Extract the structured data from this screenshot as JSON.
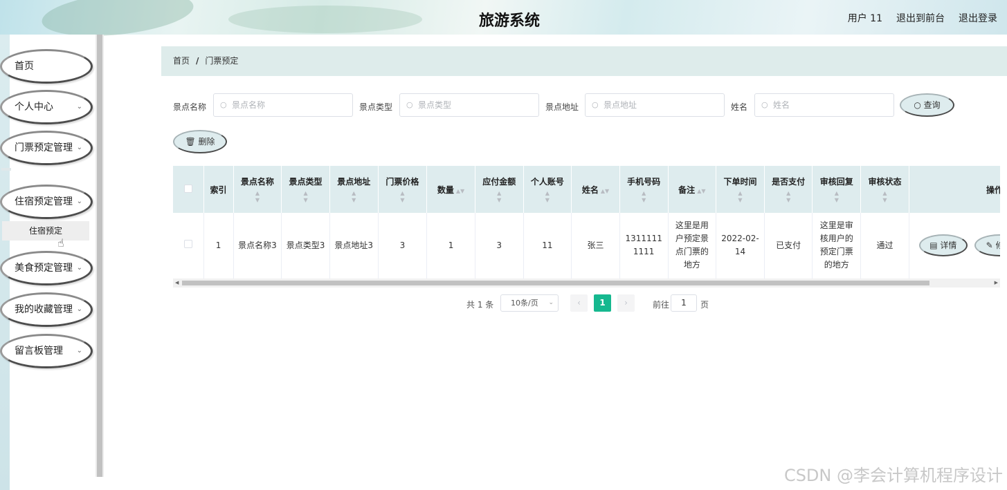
{
  "header": {
    "title": "旅游系统",
    "user": "用户 11",
    "back_front": "退出到前台",
    "logout": "退出登录"
  },
  "sidebar": {
    "items": [
      {
        "label": "首页",
        "has_chevron": false
      },
      {
        "label": "个人中心",
        "has_chevron": true
      },
      {
        "label": "门票预定管理",
        "has_chevron": true
      },
      {
        "label": "住宿预定管理",
        "has_chevron": true
      },
      {
        "label": "美食预定管理",
        "has_chevron": true
      },
      {
        "label": "我的收藏管理",
        "has_chevron": true
      },
      {
        "label": "留言板管理",
        "has_chevron": true
      }
    ],
    "submenu_item": "住宿预定"
  },
  "breadcrumb": {
    "home": "首页",
    "separator": "/",
    "current": "门票预定"
  },
  "search": {
    "fields": [
      {
        "label": "景点名称",
        "placeholder": "景点名称"
      },
      {
        "label": "景点类型",
        "placeholder": "景点类型"
      },
      {
        "label": "景点地址",
        "placeholder": "景点地址"
      },
      {
        "label": "姓名",
        "placeholder": "姓名"
      }
    ],
    "query_button": "查询",
    "delete_button": "删除"
  },
  "table": {
    "headers": [
      "索引",
      "景点名称",
      "景点类型",
      "景点地址",
      "门票价格",
      "数量",
      "应付金额",
      "个人账号",
      "姓名",
      "手机号码",
      "备注",
      "下单时间",
      "是否支付",
      "审核回复",
      "审核状态",
      "操作"
    ],
    "rows": [
      {
        "index": "1",
        "spot_name": "景点名称3",
        "spot_type": "景点类型3",
        "spot_address": "景点地址3",
        "ticket_price": "3",
        "quantity": "1",
        "amount_due": "3",
        "account": "11",
        "name": "张三",
        "phone": "13111111111",
        "remark": "这里是用户预定景点门票的地方",
        "order_time": "2022-02-14",
        "paid": "已支付",
        "review_reply": "这里是审核用户的预定门票的地方",
        "review_status": "通过",
        "detail_button": "详情",
        "edit_button": "修改"
      }
    ]
  },
  "pagination": {
    "total": "共 1 条",
    "page_size": "10条/页",
    "current_page": "1",
    "goto_label": "前往",
    "goto_value": "1",
    "page_unit": "页"
  },
  "watermark": "CSDN @李会计算机程序设计",
  "colors": {
    "accent_green": "#16b88f",
    "header_bg": "#deecee"
  }
}
